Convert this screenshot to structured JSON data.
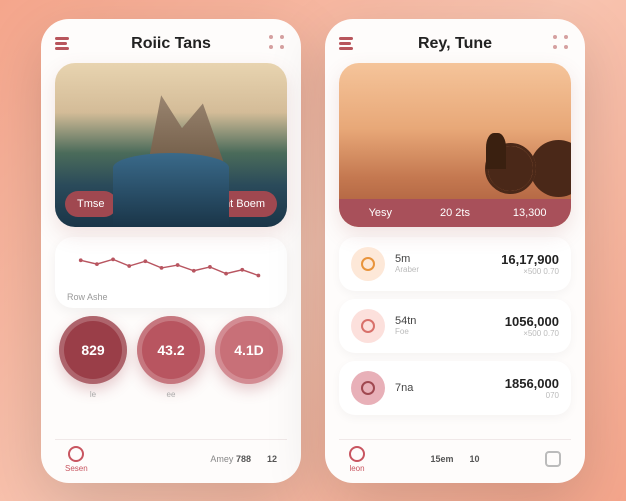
{
  "left": {
    "title": "Roiic Tans",
    "hero": {
      "pills": [
        "Tmse",
        "Unt Boem"
      ]
    },
    "chart": {
      "label": "Row Ashe"
    },
    "stats": [
      {
        "value": "829",
        "label": "le"
      },
      {
        "value": "43.2",
        "label": "ee"
      },
      {
        "value": "4.1D",
        "label": ""
      }
    ],
    "bottom": {
      "item1": "Sesen",
      "s1_label": "Amey",
      "s1_value": "788",
      "s2_label": "",
      "s2_value": "12"
    }
  },
  "right": {
    "title": "Rey, Tune",
    "hero": {
      "cells": [
        {
          "label": "Yesy"
        },
        {
          "label": "20 2ts"
        },
        {
          "label": "13,300"
        }
      ]
    },
    "items": [
      {
        "name": "5m",
        "sub": "Araber",
        "value": "16,17,900",
        "vsub": "×500  0.70"
      },
      {
        "name": "54tn",
        "sub": "Foe",
        "value": "1056,000",
        "vsub": "×500  0.70"
      },
      {
        "name": "7na",
        "sub": "",
        "value": "1856,000",
        "vsub": "070"
      }
    ],
    "bottom": {
      "item1": "leon",
      "s1_value": "15em",
      "s2_value": "10"
    }
  },
  "chart_data": {
    "type": "line",
    "x": [
      0,
      1,
      2,
      3,
      4,
      5,
      6,
      7,
      8,
      9,
      10,
      11
    ],
    "values": [
      0.65,
      0.55,
      0.68,
      0.5,
      0.62,
      0.45,
      0.52,
      0.38,
      0.48,
      0.3,
      0.4,
      0.25
    ],
    "title": "Row Ashe"
  },
  "colors": {
    "accent": "#a04850",
    "accent_light": "#c87078",
    "bg": "#fefcfb"
  }
}
